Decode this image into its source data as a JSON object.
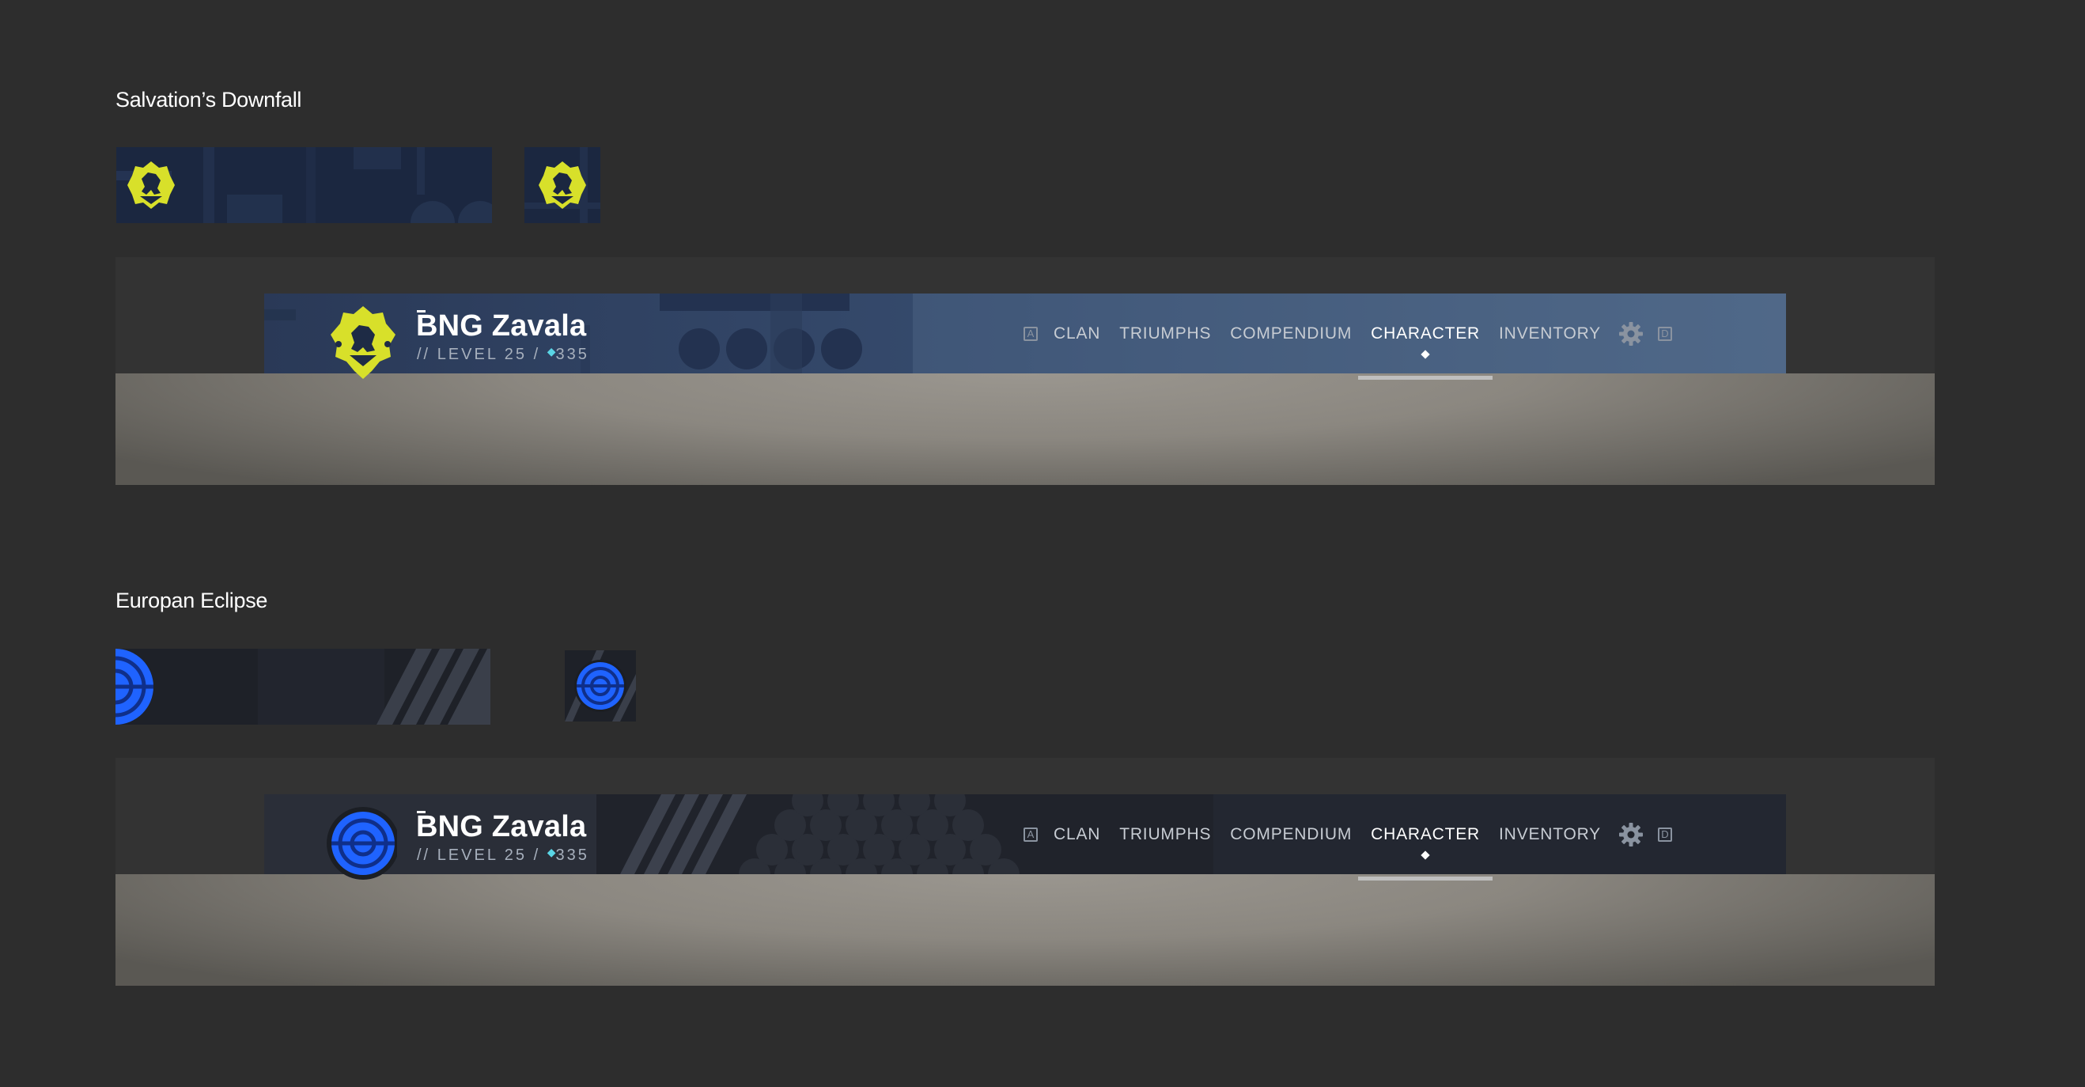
{
  "sections": [
    {
      "title": "Salvation’s Downfall",
      "theme": "yellow",
      "colors": {
        "emblem": "#d8e02a",
        "banner": "#1b2740",
        "navbar": "#3e5573"
      }
    },
    {
      "title": "Europan Eclipse",
      "theme": "blue",
      "colors": {
        "emblem": "#1f63ff",
        "banner": "#1e2128",
        "navbar": "#20232b"
      }
    }
  ],
  "player": {
    "name": "BNG Zavala",
    "level_prefix": "//",
    "level_label": "LEVEL 25 /",
    "light_icon": "diamond-icon",
    "light_value": "335"
  },
  "nav": {
    "left_key": "A",
    "right_key": "D",
    "items": [
      "CLAN",
      "TRIUMPHS",
      "COMPENDIUM",
      "CHARACTER",
      "INVENTORY"
    ],
    "active": "CHARACTER",
    "settings_icon": "gear-icon"
  }
}
